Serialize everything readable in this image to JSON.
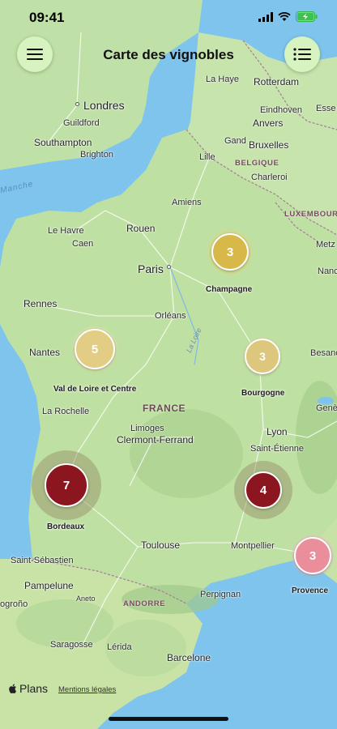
{
  "status_bar": {
    "time": "09:41"
  },
  "header": {
    "title": "Carte des vignobles"
  },
  "map": {
    "country": "FRANCE",
    "countries_small": [
      "BELGIQUE",
      "LUXEMBOURG",
      "ANDORRE"
    ],
    "sea_label": "Manche",
    "river_label": "La Loire",
    "cities": {
      "londres": "Londres",
      "guildford": "Guildford",
      "southampton": "Southampton",
      "brighton": "Brighton",
      "la_haye": "La Haye",
      "rotterdam": "Rotterdam",
      "eindhoven": "Eindhoven",
      "anvers": "Anvers",
      "essen": "Esse",
      "gand": "Gand",
      "bruxelles": "Bruxelles",
      "lille": "Lille",
      "charleroi": "Charleroi",
      "amiens": "Amiens",
      "le_havre": "Le Havre",
      "rouen": "Rouen",
      "caen": "Caen",
      "paris": "Paris",
      "metz": "Metz",
      "nancy": "Nanc",
      "rennes": "Rennes",
      "orleans": "Orléans",
      "nantes": "Nantes",
      "besancon": "Besanc",
      "la_rochelle": "La Rochelle",
      "geneve": "Genè",
      "limoges": "Limoges",
      "clermont": "Clermont-Ferrand",
      "lyon": "Lyon",
      "saint_etienne": "Saint-Étienne",
      "toulouse": "Toulouse",
      "montpellier": "Montpellier",
      "saint_sebastien": "Saint-Sébastien",
      "pampelune": "Pampelune",
      "aneto": "Aneto",
      "perpignan": "Perpignan",
      "logrono": "ogroño",
      "saragosse": "Saragosse",
      "lerida": "Lérida",
      "barcelone": "Barcelone"
    }
  },
  "clusters": [
    {
      "region": "Champagne",
      "count": "3",
      "color": "#d9b84a"
    },
    {
      "region": "Val de Loire et Centre",
      "count": "5",
      "color": "#e3cc83"
    },
    {
      "region": "Bourgogne",
      "count": "3",
      "color": "#dcc77c"
    },
    {
      "region": "Bordeaux",
      "count": "7",
      "color": "#8b1620"
    },
    {
      "region": "",
      "count": "4",
      "color": "#8b1620"
    },
    {
      "region": "Provence",
      "count": "3",
      "color": "#e98e9a"
    }
  ],
  "footer": {
    "brand": "Plans",
    "legal": "Mentions légales"
  }
}
